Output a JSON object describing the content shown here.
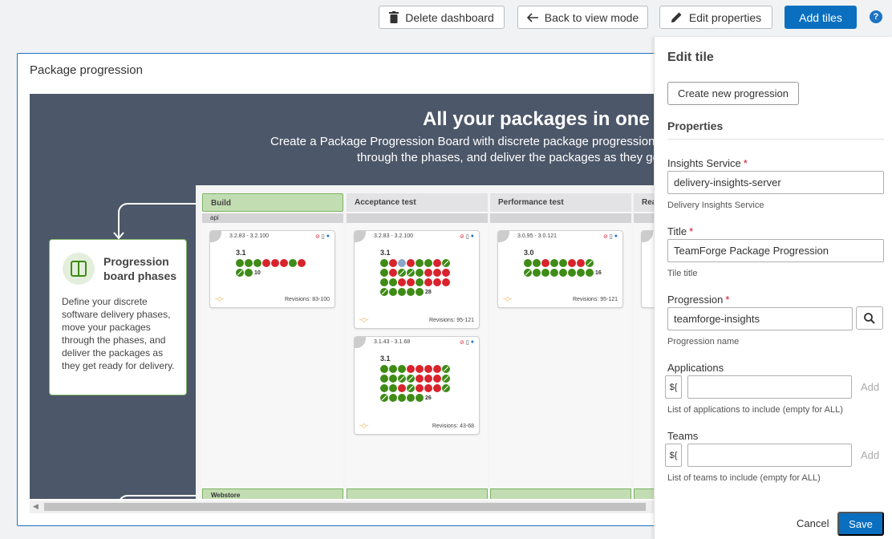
{
  "toolbar": {
    "delete_label": "Delete dashboard",
    "back_label": "Back to view mode",
    "edit_label": "Edit properties",
    "add_tiles_label": "Add tiles",
    "help_label": "?"
  },
  "card": {
    "title": "Package progression",
    "banner_title": "All your packages in one bo",
    "banner_sub_line1": "Create a Package Progression Board with discrete package progression ph",
    "banner_sub_line2": "through the phases, and deliver the packages as they get r",
    "callout_title": "Progression board phases",
    "callout_body": "Define your discrete software delivery phases, move your packages through the phases, and deliver the packages as they get ready for delivery."
  },
  "board": {
    "columns": [
      "Build",
      "Acceptance test",
      "Performance test",
      "Rea"
    ],
    "lane": "api",
    "lane2": "Webstore",
    "tiles": [
      {
        "range": "3.2.83 - 3.2.100",
        "version": "3.1",
        "count": "10",
        "revisions": "Revisions: 83-100"
      },
      {
        "range": "3.2.83 - 3.2.100",
        "version": "3.1",
        "count": "28",
        "revisions": "Revisions: 95-121"
      },
      {
        "range": "3.1.43 - 3.1.68",
        "version": "3.1",
        "count": "26",
        "revisions": "Revisions: 43-68"
      },
      {
        "range": "3.0.95 - 3.0.121",
        "version": "3.0",
        "count": "16",
        "revisions": "Revisions: 95-121"
      }
    ]
  },
  "panel": {
    "title": "Edit tile",
    "create_label": "Create new progression",
    "properties_label": "Properties",
    "insights_label": "Insights Service",
    "insights_value": "delivery-insights-server",
    "insights_help": "Delivery Insights Service",
    "title_label": "Title",
    "title_value": "TeamForge Package Progression",
    "title_help": "Tile title",
    "progression_label": "Progression",
    "progression_value": "teamforge-insights",
    "progression_help": "Progression name",
    "applications_label": "Applications",
    "applications_help": "List of applications to include (empty for ALL)",
    "teams_label": "Teams",
    "teams_help": "List of teams to include (empty for ALL)",
    "var_label": "${",
    "add_label": "Add",
    "required_mark": "*",
    "cancel_label": "Cancel",
    "save_label": "Save"
  },
  "colors": {
    "accent": "#0b6fbf",
    "success": "#3e8b16",
    "danger": "#d9232c"
  }
}
